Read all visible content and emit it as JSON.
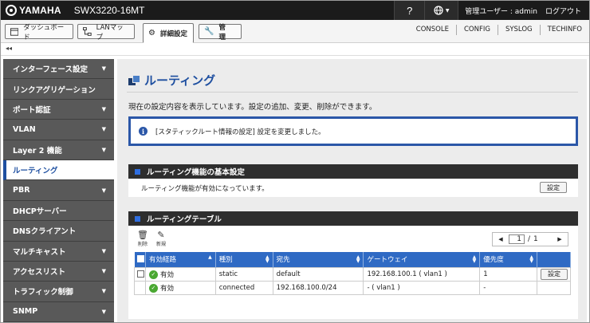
{
  "header": {
    "brand": "YAMAHA",
    "model": "SWX3220-16MT",
    "help_label": "?",
    "globe_label": "▼",
    "user_label": "管理ユーザー : admin",
    "logout_label": "ログアウト"
  },
  "nav": {
    "dashboard": "ダッシュボード",
    "lanmap": "LANマップ",
    "settings": "詳細設定",
    "management": "管　理",
    "links": [
      "CONSOLE",
      "CONFIG",
      "SYSLOG",
      "TECHINFO"
    ]
  },
  "collapse_label": "◂◂",
  "sidebar": {
    "items": [
      {
        "label": "インターフェース設定",
        "arrow": "▼"
      },
      {
        "label": "リンクアグリゲーション",
        "arrow": ""
      },
      {
        "label": "ポート認証",
        "arrow": "▼"
      },
      {
        "label": "VLAN",
        "arrow": "▼"
      },
      {
        "label": "Layer 2 機能",
        "arrow": "▼"
      },
      {
        "label": "ルーティング",
        "arrow": ""
      },
      {
        "label": "PBR",
        "arrow": "▼"
      },
      {
        "label": "DHCPサーバー",
        "arrow": ""
      },
      {
        "label": "DNSクライアント",
        "arrow": ""
      },
      {
        "label": "マルチキャスト",
        "arrow": "▼"
      },
      {
        "label": "アクセスリスト",
        "arrow": "▼"
      },
      {
        "label": "トラフィック制御",
        "arrow": "▼"
      },
      {
        "label": "SNMP",
        "arrow": "▼"
      }
    ]
  },
  "main": {
    "title": "ルーティング",
    "description": "現在の設定内容を表示しています。設定の追加、変更、削除ができます。",
    "notice": "[スタティックルート情報の設定] 設定を変更しました。",
    "basic": {
      "heading": "ルーティング機能の基本設定",
      "status": "ルーティング機能が有効になっています。",
      "button": "設定"
    },
    "table_section": {
      "heading": "ルーティングテーブル",
      "delete_label": "削除",
      "new_label": "新規",
      "pager": {
        "prev": "◀",
        "current": "1",
        "sep": "/",
        "total": "1",
        "next": "▶"
      },
      "columns": [
        "有効経路",
        "種別",
        "宛先",
        "ゲートウェイ",
        "優先度"
      ],
      "rows": [
        {
          "active": "有効",
          "type": "static",
          "dest": "default",
          "gateway": "192.168.100.1 ( vlan1 )",
          "priority": "1",
          "button": "設定"
        },
        {
          "active": "有効",
          "type": "connected",
          "dest": "192.168.100.0/24",
          "gateway": "- ( vlan1 )",
          "priority": "-",
          "button": ""
        }
      ]
    }
  }
}
